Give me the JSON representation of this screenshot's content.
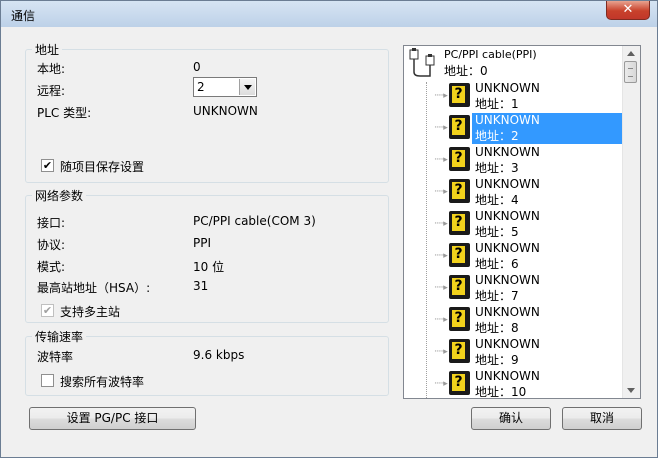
{
  "window": {
    "title": "通信",
    "close_glyph": "✕"
  },
  "address_group": {
    "title": "地址",
    "local_label": "本地:",
    "local_value": "0",
    "remote_label": "远程:",
    "remote_value": "2",
    "plc_type_label": "PLC 类型:",
    "plc_type_value": "UNKNOWN",
    "save_with_project_label": "随项目保存设置",
    "save_with_project_checked": true
  },
  "network_group": {
    "title": "网络参数",
    "interface_label": "接口:",
    "interface_value": "PC/PPI cable(COM 3)",
    "protocol_label": "协议:",
    "protocol_value": "PPI",
    "mode_label": "模式:",
    "mode_value": "10 位",
    "hsa_label": "最高站地址（HSA）:",
    "hsa_value": "31",
    "multi_master_label": "支持多主站",
    "multi_master_checked": true
  },
  "baud_group": {
    "title": "传输速率",
    "baud_label": "波特率",
    "baud_value": "9.6 kbps",
    "search_all_label": "搜索所有波特率",
    "search_all_checked": false
  },
  "tree": {
    "root": {
      "line1": "PC/PPI cable(PPI)",
      "line2": "地址：0"
    },
    "nodes": [
      {
        "line1": "UNKNOWN",
        "line2": "地址：1",
        "selected": false
      },
      {
        "line1": "UNKNOWN",
        "line2": "地址：2",
        "selected": true
      },
      {
        "line1": "UNKNOWN",
        "line2": "地址：3",
        "selected": false
      },
      {
        "line1": "UNKNOWN",
        "line2": "地址：4",
        "selected": false
      },
      {
        "line1": "UNKNOWN",
        "line2": "地址：5",
        "selected": false
      },
      {
        "line1": "UNKNOWN",
        "line2": "地址：6",
        "selected": false
      },
      {
        "line1": "UNKNOWN",
        "line2": "地址：7",
        "selected": false
      },
      {
        "line1": "UNKNOWN",
        "line2": "地址：8",
        "selected": false
      },
      {
        "line1": "UNKNOWN",
        "line2": "地址：9",
        "selected": false
      },
      {
        "line1": "UNKNOWN",
        "line2": "地址：10",
        "selected": false
      }
    ]
  },
  "buttons": {
    "set_pgpc": "设置 PG/PC 接口",
    "ok": "确认",
    "cancel": "取消"
  },
  "colors": {
    "selection": "#3399ff",
    "icon_yellow": "#f2d21c"
  }
}
